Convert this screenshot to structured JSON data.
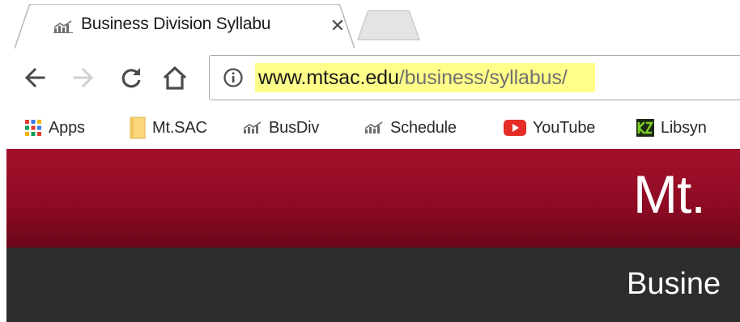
{
  "browser": {
    "tab": {
      "title": "Business Division Syllabu",
      "close_glyph": "✕",
      "favicon": "busdiv-chart-icon"
    },
    "toolbar": {
      "back_icon": "back-arrow-icon",
      "forward_icon": "forward-arrow-icon",
      "reload_icon": "reload-icon",
      "home_icon": "home-icon"
    },
    "omnibox": {
      "info_icon": "info-icon",
      "url_host": "www.mtsac.edu",
      "url_path": "/business/syllabus/",
      "highlight_color": "#ffff8a"
    },
    "bookmarks": [
      {
        "label": "Apps",
        "icon": "apps-grid-icon"
      },
      {
        "label": "Mt.SAC",
        "icon": "folder-icon"
      },
      {
        "label": "BusDiv",
        "icon": "busdiv-chart-icon"
      },
      {
        "label": "Schedule",
        "icon": "busdiv-chart-icon"
      },
      {
        "label": "YouTube",
        "icon": "youtube-icon"
      },
      {
        "label": "Libsyn",
        "icon": "libsyn-icon"
      }
    ]
  },
  "page": {
    "header_text": "Mt.",
    "subnav_text": "Busine",
    "colors": {
      "header_red": "#8f0b24",
      "subnav_dark": "#2d2d2d"
    }
  }
}
